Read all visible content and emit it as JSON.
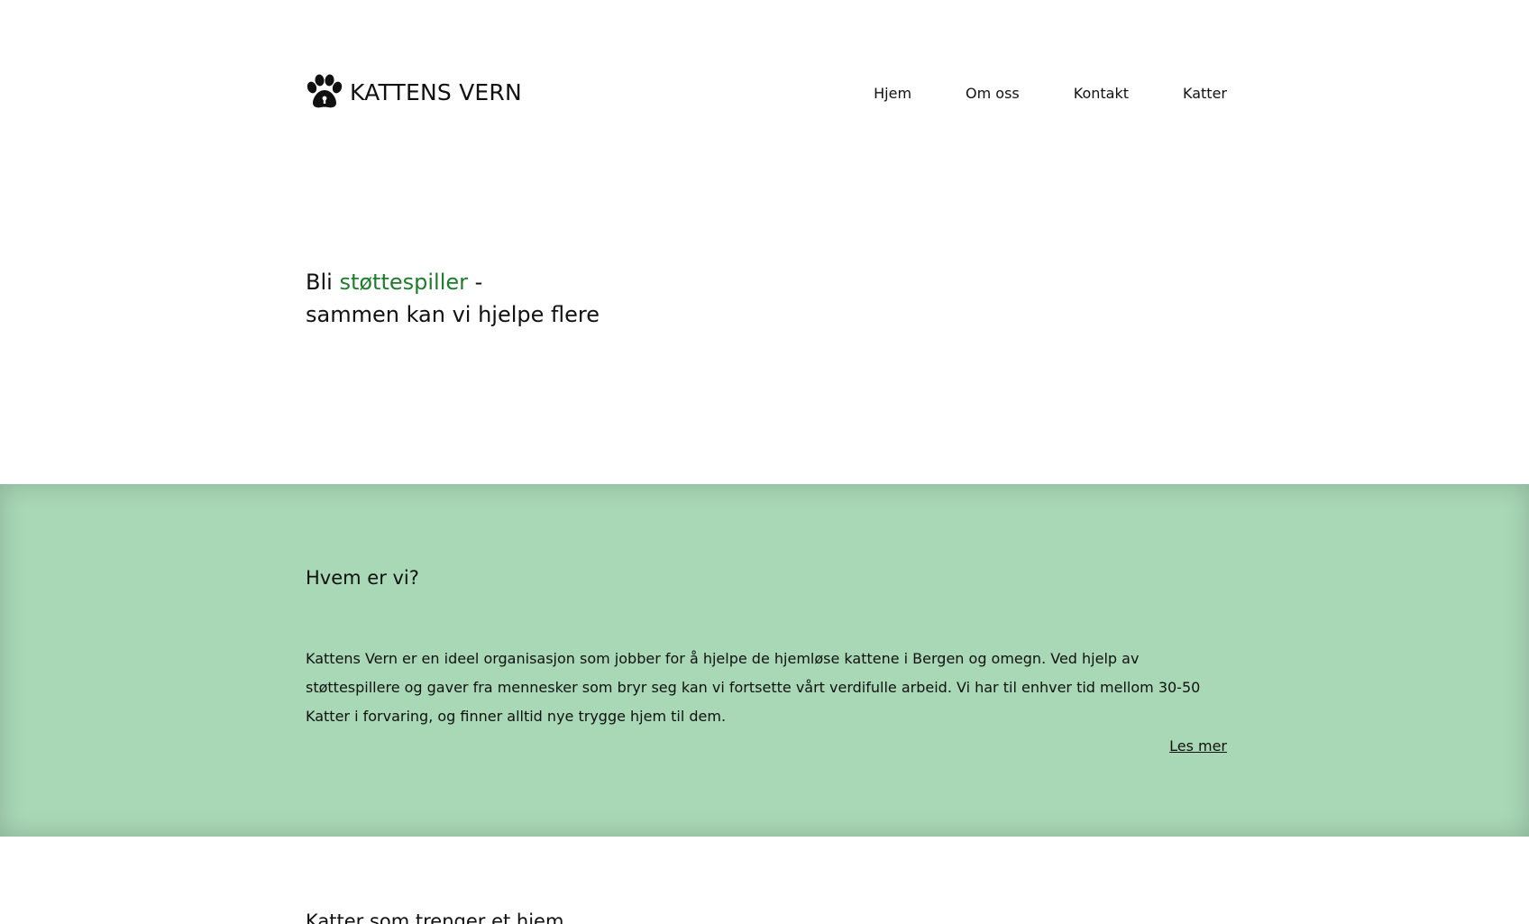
{
  "header": {
    "logo_text": "KATTENS VERN",
    "logo_icon": "paw-icon",
    "nav": [
      {
        "label": "Hjem"
      },
      {
        "label": "Om oss"
      },
      {
        "label": "Kontakt"
      },
      {
        "label": "Katter"
      }
    ]
  },
  "hero": {
    "line1_prefix": "Bli ",
    "line1_accent": "støttespiller",
    "line1_suffix": " -",
    "line2": "sammen kan vi hjelpe flere",
    "accent_color": "#1e7d2c"
  },
  "about": {
    "heading": "Hvem er vi?",
    "text": "Kattens Vern er en ideel organisasjon som jobber for å hjelpe de hjemløse kattene i Bergen og omegn. Ved hjelp av støttespillere og gaver fra mennesker som bryr seg kan vi fortsette vårt verdifulle arbeid. Vi har til enhver tid mellom 30-50 Katter i forvaring, og finner alltid nye trygge hjem til dem.",
    "read_more": "Les mer",
    "background_color": "#a8d8b6"
  },
  "cats": {
    "heading": "Katter som trenger et hjem"
  }
}
